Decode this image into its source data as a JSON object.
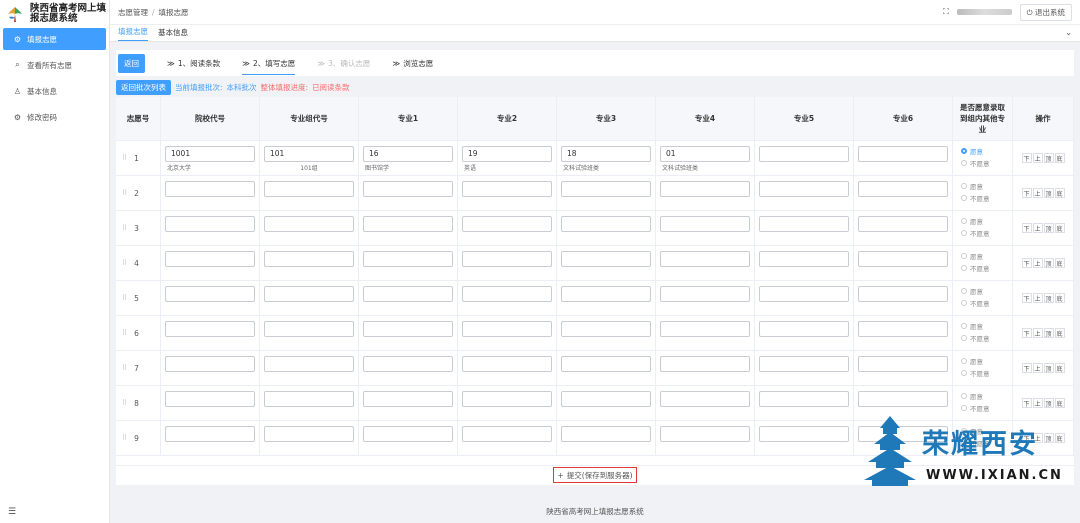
{
  "app": {
    "logo_title": "陕西省高考网上填报志愿系统",
    "footer": "陕西省高考网上填报志愿系统"
  },
  "sidebar": {
    "items": [
      {
        "label": "填报志愿",
        "icon": "gear-icon",
        "active": true
      },
      {
        "label": "查看所有志愿",
        "icon": "search-icon",
        "active": false
      },
      {
        "label": "基本信息",
        "icon": "user-icon",
        "active": false
      },
      {
        "label": "修改密码",
        "icon": "gear-icon",
        "active": false
      }
    ]
  },
  "header": {
    "breadcrumb": [
      "志愿管理",
      "填报志愿"
    ],
    "logout_label": "退出系统"
  },
  "tabs": [
    {
      "label": "填报志愿",
      "active": true
    },
    {
      "label": "基本信息",
      "active": false
    }
  ],
  "steps": {
    "back_label": "返回",
    "items": [
      {
        "label": "1、阅读条款",
        "state": "done"
      },
      {
        "label": "2、填写志愿",
        "state": "active"
      },
      {
        "label": "3、确认志愿",
        "state": "disabled"
      },
      {
        "label": "浏览志愿",
        "state": "done"
      }
    ]
  },
  "status": {
    "back_batch_label": "返回批次列表",
    "current_batch_label": "当前填报批次:",
    "current_batch_value": "本科批次",
    "progress_label": "整体填报进度:",
    "progress_value": "已阅读条款"
  },
  "table": {
    "headers": [
      "志愿号",
      "院校代号",
      "专业组代号",
      "专业1",
      "专业2",
      "专业3",
      "专业4",
      "专业5",
      "专业6",
      "是否愿意录取到组内其他专业",
      "操作"
    ],
    "radio_yes": "愿意",
    "radio_no": "不愿意",
    "ops": [
      "下",
      "上",
      "顶",
      "底"
    ],
    "rows": [
      {
        "no": "1",
        "cells": [
          "1001",
          "101",
          "16",
          "19",
          "18",
          "01",
          "",
          ""
        ],
        "subs": [
          "北京大学",
          "101组",
          "图书馆学",
          "英语",
          "文科试验班类",
          "文科试验班类",
          "",
          ""
        ],
        "willing": true
      },
      {
        "no": "2",
        "cells": [
          "",
          "",
          "",
          "",
          "",
          "",
          "",
          ""
        ],
        "subs": [
          "",
          "",
          "",
          "",
          "",
          "",
          "",
          ""
        ],
        "willing": false
      },
      {
        "no": "3",
        "cells": [
          "",
          "",
          "",
          "",
          "",
          "",
          "",
          ""
        ],
        "subs": [
          "",
          "",
          "",
          "",
          "",
          "",
          "",
          ""
        ],
        "willing": false
      },
      {
        "no": "4",
        "cells": [
          "",
          "",
          "",
          "",
          "",
          "",
          "",
          ""
        ],
        "subs": [
          "",
          "",
          "",
          "",
          "",
          "",
          "",
          ""
        ],
        "willing": false
      },
      {
        "no": "5",
        "cells": [
          "",
          "",
          "",
          "",
          "",
          "",
          "",
          ""
        ],
        "subs": [
          "",
          "",
          "",
          "",
          "",
          "",
          "",
          ""
        ],
        "willing": false
      },
      {
        "no": "6",
        "cells": [
          "",
          "",
          "",
          "",
          "",
          "",
          "",
          ""
        ],
        "subs": [
          "",
          "",
          "",
          "",
          "",
          "",
          "",
          ""
        ],
        "willing": false
      },
      {
        "no": "7",
        "cells": [
          "",
          "",
          "",
          "",
          "",
          "",
          "",
          ""
        ],
        "subs": [
          "",
          "",
          "",
          "",
          "",
          "",
          "",
          ""
        ],
        "willing": false
      },
      {
        "no": "8",
        "cells": [
          "",
          "",
          "",
          "",
          "",
          "",
          "",
          ""
        ],
        "subs": [
          "",
          "",
          "",
          "",
          "",
          "",
          "",
          ""
        ],
        "willing": false
      },
      {
        "no": "9",
        "cells": [
          "",
          "",
          "",
          "",
          "",
          "",
          "",
          ""
        ],
        "subs": [
          "",
          "",
          "",
          "",
          "",
          "",
          "",
          ""
        ],
        "willing": false
      }
    ]
  },
  "submit_label": "提交(保存到服务器)",
  "watermark": {
    "text": "荣耀西安",
    "url": "WWW.IXIAN.CN"
  },
  "colors": {
    "primary": "#409eff",
    "danger": "#f56c6c",
    "watermark": "#1f78b8"
  }
}
